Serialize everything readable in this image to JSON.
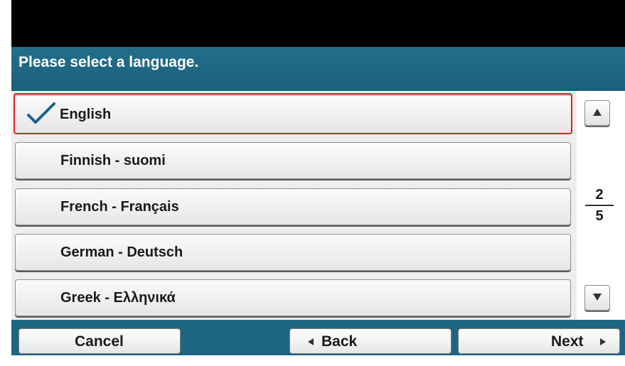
{
  "header": {
    "title": "Please select a language."
  },
  "languages": [
    {
      "label": "English",
      "selected": true
    },
    {
      "label": "Finnish - suomi",
      "selected": false
    },
    {
      "label": "French - Français",
      "selected": false
    },
    {
      "label": "German - Deutsch",
      "selected": false
    },
    {
      "label": "Greek - Ελληνικά",
      "selected": false
    }
  ],
  "pager": {
    "current": "2",
    "total": "5",
    "up_icon": "triangle-up-icon",
    "down_icon": "triangle-down-icon"
  },
  "footer": {
    "cancel_label": "Cancel",
    "back_label": "Back",
    "next_label": "Next"
  },
  "colors": {
    "header_bg": "#1f6a86",
    "selected_border": "#e0201c",
    "check": "#1d5f8c"
  }
}
